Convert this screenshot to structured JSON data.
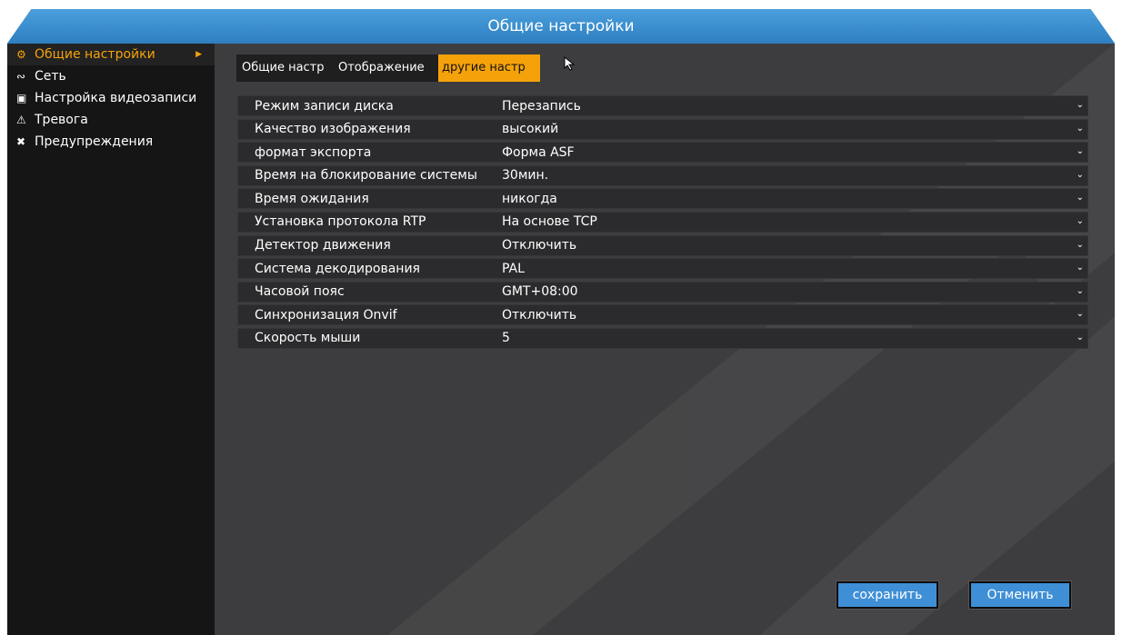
{
  "window": {
    "title": "Общие настройки"
  },
  "sidebar": {
    "items": [
      {
        "label": "Общие настройки",
        "icon": "gears-icon",
        "active": true
      },
      {
        "label": "Сеть",
        "icon": "network-icon",
        "active": false
      },
      {
        "label": "Настройка видеозаписи",
        "icon": "film-icon",
        "active": false
      },
      {
        "label": "Тревога",
        "icon": "warning-icon",
        "active": false
      },
      {
        "label": "Предупреждения",
        "icon": "tools-icon",
        "active": false
      }
    ]
  },
  "tabs": [
    {
      "label": "Общие настр"
    },
    {
      "label": "Отображение"
    },
    {
      "label": "другие  настр"
    }
  ],
  "settings": [
    {
      "label": "Режим записи диска",
      "value": "Перезапись"
    },
    {
      "label": "Качество изображения",
      "value": "высокий"
    },
    {
      "label": "формат экспорта",
      "value": "Форма ASF"
    },
    {
      "label": "Время на блокирование системы",
      "value": "30мин."
    },
    {
      "label": "Время ожидания",
      "value": "никогда"
    },
    {
      "label": "Установка протокола RTP",
      "value": "На основе TCP"
    },
    {
      "label": "Детектор движения",
      "value": "Отключить"
    },
    {
      "label": "Система декодирования",
      "value": "PAL"
    },
    {
      "label": "Часовой пояс",
      "value": "GMT+08:00"
    },
    {
      "label": "Синхронизация Onvif",
      "value": "Отключить"
    },
    {
      "label": "Скорость мыши",
      "value": "5"
    }
  ],
  "buttons": {
    "save": "сохранить",
    "cancel": "Отменить"
  },
  "colors": {
    "accent": "#f5a20a",
    "title_bar": "#3b8fd0",
    "button": "#3f8fd6"
  }
}
